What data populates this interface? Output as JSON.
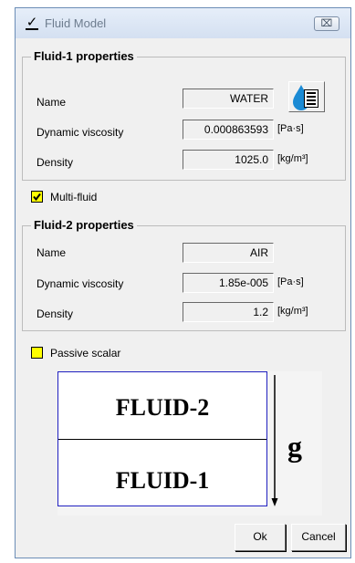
{
  "window": {
    "title": "Fluid Model",
    "close_glyph": "⌧"
  },
  "fluid1": {
    "legend": "Fluid-1 properties",
    "name_label": "Name",
    "name_value": "WATER",
    "viscosity_label": "Dynamic viscosity",
    "viscosity_value": "0.000863593",
    "viscosity_unit": "[Pa·s]",
    "density_label": "Density",
    "density_value": "1025.0",
    "density_unit": "[kg/m³]"
  },
  "multi_fluid": {
    "label": "Multi-fluid",
    "checked": true
  },
  "fluid2": {
    "legend": "Fluid-2 properties",
    "name_label": "Name",
    "name_value": "AIR",
    "viscosity_label": "Dynamic viscosity",
    "viscosity_value": "1.85e-005",
    "viscosity_unit": "[Pa·s]",
    "density_label": "Density",
    "density_value": "1.2",
    "density_unit": "[kg/m³]"
  },
  "passive_scalar": {
    "label": "Passive scalar",
    "checked": false
  },
  "diagram": {
    "upper": "FLUID-2",
    "lower": "FLUID-1",
    "gravity": "g"
  },
  "buttons": {
    "ok": "Ok",
    "cancel": "Cancel"
  },
  "colors": {
    "checkbox": "#ffff00",
    "drop": "#1a8ad4",
    "diagram_border": "#2020c0",
    "window_bg": "#f0f0f0"
  }
}
